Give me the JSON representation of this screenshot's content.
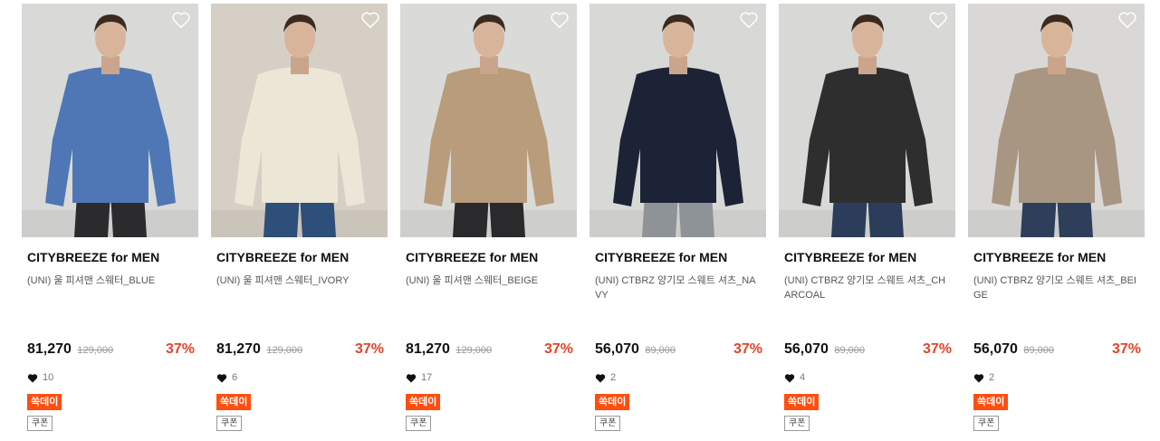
{
  "products": [
    {
      "brand": "CITYBREEZE for MEN",
      "name": "(UNI) 울 피셔맨 스웨터_BLUE",
      "price": "81,270",
      "original": "129,000",
      "discount": "37%",
      "likes": "10",
      "badge": "쏙데이",
      "coupon": "쿠폰",
      "bg": "#d9d9d7",
      "top": "#4f77b5",
      "pants": "#2b2b2e"
    },
    {
      "brand": "CITYBREEZE for MEN",
      "name": "(UNI) 울 피셔맨 스웨터_IVORY",
      "price": "81,270",
      "original": "129,000",
      "discount": "37%",
      "likes": "6",
      "badge": "쏙데이",
      "coupon": "쿠폰",
      "bg": "#d6cfc5",
      "top": "#ece6d6",
      "pants": "#2d4f7a"
    },
    {
      "brand": "CITYBREEZE for MEN",
      "name": "(UNI) 울 피셔맨 스웨터_BEIGE",
      "price": "81,270",
      "original": "129,000",
      "discount": "37%",
      "likes": "17",
      "badge": "쏙데이",
      "coupon": "쿠폰",
      "bg": "#dadad8",
      "top": "#b89c7b",
      "pants": "#2a2a2c"
    },
    {
      "brand": "CITYBREEZE for MEN",
      "name": "(UNI) CTBRZ 양기모 스웨트 셔츠_NAVY",
      "price": "56,070",
      "original": "89,000",
      "discount": "37%",
      "likes": "2",
      "badge": "쏙데이",
      "coupon": "쿠폰",
      "bg": "#d8d8d6",
      "top": "#1d2336",
      "pants": "#8e9398"
    },
    {
      "brand": "CITYBREEZE for MEN",
      "name": "(UNI) CTBRZ 양기모 스웨트 셔츠_CHARCOAL",
      "price": "56,070",
      "original": "89,000",
      "discount": "37%",
      "likes": "4",
      "badge": "쏙데이",
      "coupon": "쿠폰",
      "bg": "#d8d8d6",
      "top": "#2f2e2e",
      "pants": "#2b3d5a"
    },
    {
      "brand": "CITYBREEZE for MEN",
      "name": "(UNI) CTBRZ 양기모 스웨트 셔츠_BEIGE",
      "price": "56,070",
      "original": "89,000",
      "discount": "37%",
      "likes": "2",
      "badge": "쏙데이",
      "coupon": "쿠폰",
      "bg": "#d9d8d6",
      "top": "#a89683",
      "pants": "#2e3f5c"
    }
  ]
}
